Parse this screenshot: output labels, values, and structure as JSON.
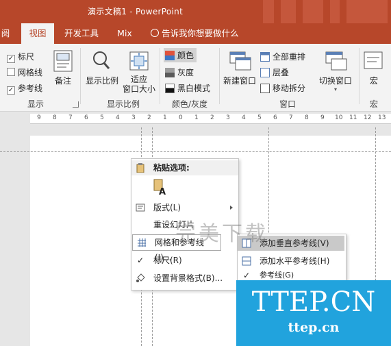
{
  "window": {
    "title": "演示文稿1  -  PowerPoint"
  },
  "tabs": {
    "review_partial": "阅",
    "view": "视图",
    "developer": "开发工具",
    "mix": "Mix",
    "tell_me": "告诉我你想要做什么"
  },
  "ribbon": {
    "show": {
      "ruler": "标尺",
      "gridlines": "网格线",
      "guides": "参考线",
      "notes": "备注",
      "group": "显示"
    },
    "zoom": {
      "zoom": "显示比例",
      "fit_line1": "适应",
      "fit_line2": "窗口大小",
      "group": "显示比例"
    },
    "color": {
      "color": "颜色",
      "grayscale": "灰度",
      "bw": "黑白模式",
      "group": "颜色/灰度"
    },
    "window": {
      "new_window": "新建窗口",
      "arrange_all": "全部重排",
      "cascade": "层叠",
      "move_split": "移动拆分",
      "switch_windows": "切换窗口",
      "group": "窗口"
    },
    "macro": {
      "macros": "宏",
      "group": "宏"
    }
  },
  "ruler": {
    "labels": [
      "9",
      "8",
      "7",
      "6",
      "5",
      "4",
      "3",
      "2",
      "1",
      "0",
      "1",
      "2",
      "3",
      "4",
      "5",
      "6",
      "7",
      "8",
      "9",
      "10",
      "11",
      "12",
      "13"
    ]
  },
  "context_menu": {
    "paste_options": "粘贴选项:",
    "layout": "版式(L)",
    "reset_slide": "重设幻灯片",
    "grid_guides": "网格和参考线(I)...",
    "ruler": "标尺(R)",
    "format_background": "设置背景格式(B)..."
  },
  "submenu": {
    "add_vertical": "添加垂直参考线(V)",
    "add_horizontal": "添加水平参考线(H)",
    "guides": "参考线(G)"
  },
  "watermark": {
    "cn": "完美下载",
    "big": "TTEP.CN",
    "small": "ttep.cn"
  },
  "colors": {
    "accent": "#b7472a",
    "ribbon": "#f3f3f3",
    "watermark_bg": "#21a3dd"
  }
}
